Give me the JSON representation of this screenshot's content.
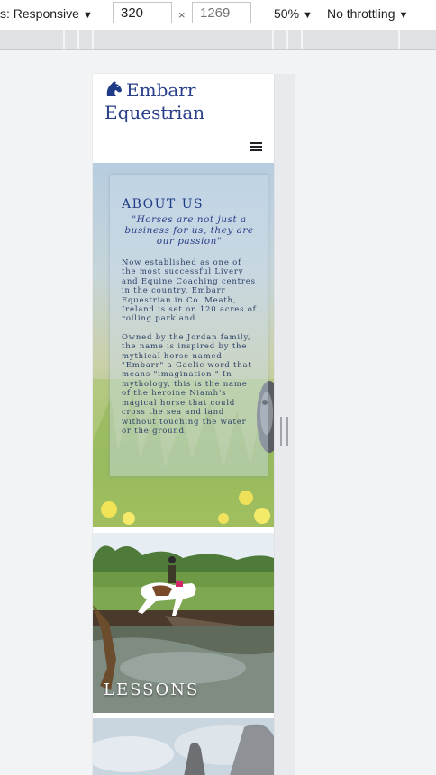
{
  "devtools": {
    "device_label": "s: Responsive",
    "width_value": "320",
    "height_placeholder": "1269",
    "times": "×",
    "zoom": "50%",
    "throttling": "No throttling",
    "caret": "▼"
  },
  "site": {
    "brand_name": "Embarr Equestrian",
    "about": {
      "title": "ABOUT US",
      "quote": "\"Horses are not just a business for us, they are our passion\"",
      "paragraph_1": "Now established as one of the most successful Livery and Equine Coaching centres in the country, Embarr Equestrian in Co. Meath, Ireland is set on 120 acres of rolling parkland.",
      "paragraph_2": "Owned by the Jordan family, the name is inspired by the mythical horse named \"Embarr\" a Gaelic word that means \"imagination.\" In mythology, this is the name of the heroine Niamh's magical horse that could cross the sea and land without touching the water or the ground."
    },
    "lessons_label": "LESSONS"
  },
  "colors": {
    "brand": "#2a3f8a",
    "devtools_bg": "#f1f3f4"
  }
}
